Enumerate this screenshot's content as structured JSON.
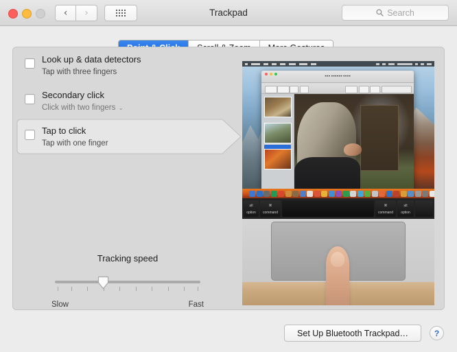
{
  "window": {
    "title": "Trackpad",
    "traffic_lights": [
      "close",
      "minimize",
      "zoom"
    ],
    "nav_back_icon": "chevron-left-icon",
    "nav_forward_icon": "chevron-right-icon",
    "show_all_icon": "grid-icon"
  },
  "search": {
    "placeholder": "Search",
    "value": "",
    "icon": "search-icon"
  },
  "tabs": [
    {
      "label": "Point & Click",
      "active": true
    },
    {
      "label": "Scroll & Zoom",
      "active": false
    },
    {
      "label": "More Gestures",
      "active": false
    }
  ],
  "options": [
    {
      "title": "Look up & data detectors",
      "subtitle": "Tap with three fingers",
      "checked": false,
      "is_menu": false,
      "selected": false
    },
    {
      "title": "Secondary click",
      "subtitle": "Click with two fingers",
      "checked": false,
      "is_menu": true,
      "menu_caret": "⌄",
      "selected": false
    },
    {
      "title": "Tap to click",
      "subtitle": "Tap with one finger",
      "checked": false,
      "is_menu": false,
      "selected": true
    }
  ],
  "tracking": {
    "label": "Tracking speed",
    "min_label": "Slow",
    "max_label": "Fast",
    "tick_count": 10,
    "value_index": 3
  },
  "preview": {
    "description": "Tap to click demonstration video",
    "desktop_app": "Photos",
    "key_labels": {
      "option_left": "option",
      "command_left": "command",
      "command_right": "command",
      "option_right": "option",
      "alt_left": "alt",
      "alt_right": "alt",
      "command_symbol": "⌘"
    }
  },
  "footer": {
    "bluetooth_button": "Set Up Bluetooth Trackpad…",
    "help_button": "?",
    "help_icon": "help-icon"
  },
  "colors": {
    "accent_blue": "#1668e0",
    "window_bg": "#ececec",
    "panel_bg": "#d8d8d8"
  }
}
